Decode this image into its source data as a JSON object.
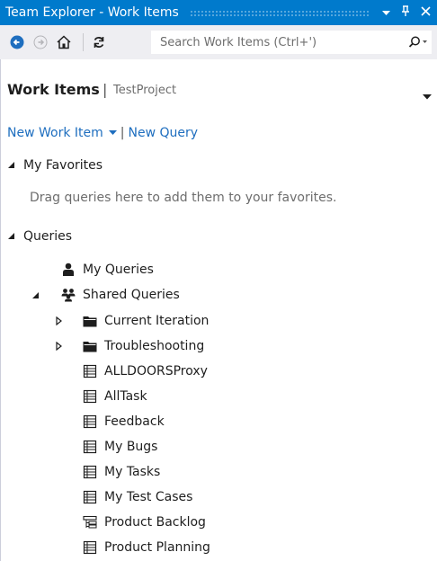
{
  "window": {
    "title": "Team Explorer - Work Items",
    "pin_glyph": "I",
    "close_glyph": "✕"
  },
  "toolbar": {
    "search_placeholder": "Search Work Items (Ctrl+')"
  },
  "header": {
    "title": "Work Items",
    "separator": "|",
    "project": "TestProject"
  },
  "actions": {
    "new_work_item": "New Work Item",
    "divider": "|",
    "new_query": "New Query"
  },
  "favorites": {
    "label": "My Favorites",
    "hint": "Drag queries here to add them to your favorites."
  },
  "queries": {
    "label": "Queries",
    "my_queries": "My Queries",
    "shared_queries": "Shared Queries",
    "folders": [
      "Current Iteration",
      "Troubleshooting"
    ],
    "items": [
      {
        "label": "ALLDOORSProxy",
        "icon": "flat-list-query-icon"
      },
      {
        "label": "AllTask",
        "icon": "flat-list-query-icon"
      },
      {
        "label": "Feedback",
        "icon": "flat-list-query-icon"
      },
      {
        "label": "My Bugs",
        "icon": "flat-list-query-icon"
      },
      {
        "label": "My Tasks",
        "icon": "flat-list-query-icon"
      },
      {
        "label": "My Test Cases",
        "icon": "flat-list-query-icon"
      },
      {
        "label": "Product Backlog",
        "icon": "tree-query-icon"
      },
      {
        "label": "Product Planning",
        "icon": "flat-list-query-icon"
      }
    ]
  },
  "colors": {
    "accent": "#007acc",
    "link": "#1e6ebf",
    "toolbar_bg": "#eeeef2"
  }
}
